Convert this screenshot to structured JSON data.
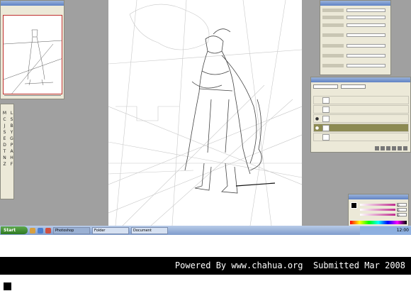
{
  "taskbar": {
    "start_label": "Start",
    "tasks": [
      {
        "label": "Photoshop",
        "active": true
      },
      {
        "label": "Folder",
        "active": false
      },
      {
        "label": "Document",
        "active": false
      }
    ],
    "clock": "12:00"
  },
  "tools": [
    "M",
    "L",
    "C",
    "S",
    "J",
    "B",
    "S",
    "Y",
    "E",
    "G",
    "D",
    "P",
    "T",
    "A",
    "N",
    "H",
    "Z",
    "F"
  ],
  "layers": {
    "rows": [
      {
        "name": "",
        "visible": false,
        "selected": false
      },
      {
        "name": "",
        "visible": false,
        "selected": false
      },
      {
        "name": "",
        "visible": true,
        "selected": false
      },
      {
        "name": "",
        "visible": true,
        "selected": true
      },
      {
        "name": "",
        "visible": false,
        "selected": false
      }
    ]
  },
  "color_values": [
    "0",
    "0",
    "0"
  ],
  "footer": {
    "text": "Powered By www.chahua.org  Submitted Mar 2008"
  },
  "colors": {
    "workspace": "#a0a0a0",
    "palette_bg": "#ece9d8",
    "selected_layer": "#8c8a52",
    "footer_bg": "#000000"
  }
}
